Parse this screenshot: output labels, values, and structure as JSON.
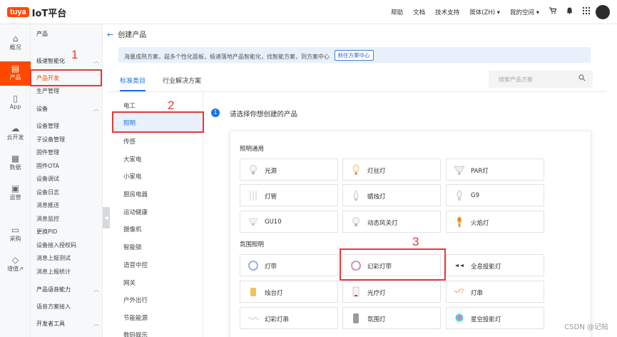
{
  "brand": {
    "badge": "tuya",
    "title": "IoT平台"
  },
  "topnav": {
    "help": "帮助",
    "docs": "文档",
    "support": "技术支持",
    "lang": "简体(ZH) ▾",
    "space": "我的空间 ▾"
  },
  "rail": [
    {
      "icon": "⌂",
      "label": "概况"
    },
    {
      "icon": "▤",
      "label": "产品"
    },
    {
      "icon": "▯",
      "label": "App"
    },
    {
      "icon": "☁",
      "label": "云开发"
    },
    {
      "icon": "▦",
      "label": "数据"
    },
    {
      "icon": "▣",
      "label": "运营"
    },
    {
      "icon": "▭",
      "label": "采购"
    },
    {
      "icon": "◇",
      "label": "增值↗"
    }
  ],
  "side": {
    "title": "产品",
    "items": [
      {
        "label": "极速智能化",
        "group": true
      },
      {
        "label": "产品开发"
      },
      {
        "label": "生产管理"
      },
      {
        "label": "设备",
        "group": true
      },
      {
        "label": "设备管理"
      },
      {
        "label": "子设备管理"
      },
      {
        "label": "固件管理"
      },
      {
        "label": "固件OTA"
      },
      {
        "label": "设备调试"
      },
      {
        "label": "设备日志"
      },
      {
        "label": "消息推送"
      },
      {
        "label": "消息监控"
      },
      {
        "label": "更换PID"
      },
      {
        "label": "设备接入授权码"
      },
      {
        "label": "消息上报测试"
      },
      {
        "label": "消息上报统计"
      },
      {
        "label": "产品语音能力",
        "group": true
      },
      {
        "label": "语音方案接入"
      },
      {
        "label": "开发者工具",
        "group": true
      }
    ]
  },
  "header": {
    "title": "创建产品"
  },
  "notice": {
    "text": "海量成熟方案，超多个性化面板，极速落地产品智能化，找智能方案，到方案中心",
    "button": "前往方案中心"
  },
  "tabs": [
    "标准类目",
    "行业解决方案"
  ],
  "search": {
    "placeholder": "搜索产品方案"
  },
  "categories": [
    "电工",
    "照明",
    "传感",
    "大家电",
    "小家电",
    "厨房电器",
    "运动健康",
    "摄像机",
    "智能锁",
    "语音中控",
    "网关",
    "户外出行",
    "节能能源",
    "数码娱乐"
  ],
  "step": {
    "num": "1",
    "text": "请选择你想创建的产品"
  },
  "groups": [
    {
      "title": "照明通用",
      "items": [
        "光源",
        "灯丝灯",
        "PAR灯",
        "灯管",
        "蜡烛灯",
        "G9",
        "GU10",
        "动态风关灯",
        "火焰灯"
      ]
    },
    {
      "title": "氛围照明",
      "items": [
        "灯带",
        "幻彩灯带",
        "全息投影灯",
        "烛台灯",
        "光疗灯",
        "灯串",
        "幻彩灯串",
        "氛围灯",
        "星空投影灯"
      ]
    }
  ],
  "annotations": [
    "1",
    "2",
    "3"
  ],
  "watermark": "CSDN @记帖",
  "colors": {
    "brand": "#ff4800",
    "accent": "#1a73e8",
    "annotation": "#e53935"
  }
}
